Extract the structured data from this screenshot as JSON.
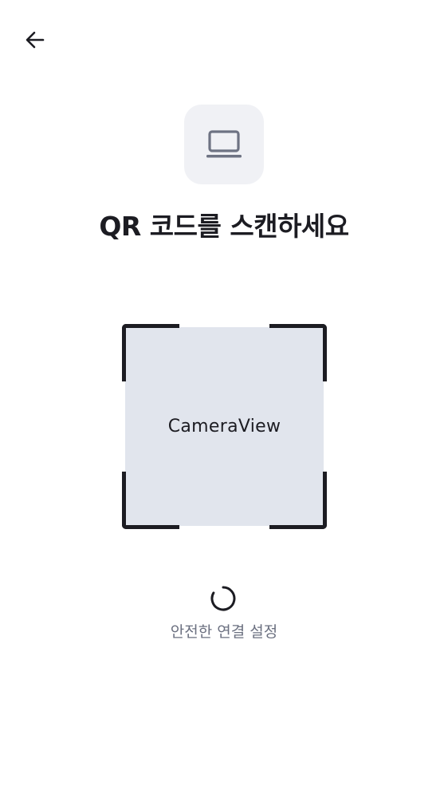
{
  "header": {
    "back_icon": "arrow-left-icon"
  },
  "device": {
    "icon": "laptop-icon",
    "badge_color": "#f0f1f5"
  },
  "title": "QR 코드를 스캔하세요",
  "scanner": {
    "camera_label": "CameraView",
    "frame_color": "#1c1c22",
    "view_color": "#e1e5ed"
  },
  "status": {
    "spinner_icon": "loading-spinner-icon",
    "text": "안전한 연결 설정"
  }
}
